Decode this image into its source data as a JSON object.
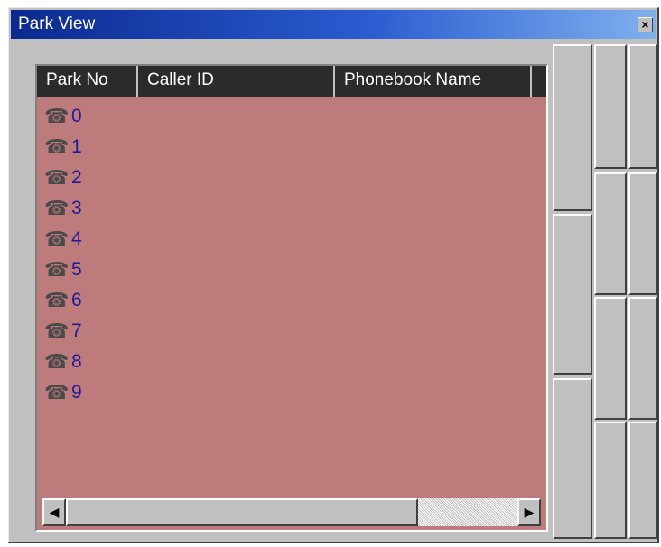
{
  "window": {
    "title": "Park View",
    "close_label": "×"
  },
  "columns": [
    {
      "label": "Park No"
    },
    {
      "label": "Caller ID"
    },
    {
      "label": "Phonebook Name"
    }
  ],
  "rows": [
    {
      "park_no": "0",
      "icon": "phone-icon"
    },
    {
      "park_no": "1",
      "icon": "phone-icon"
    },
    {
      "park_no": "2",
      "icon": "phone-icon"
    },
    {
      "park_no": "3",
      "icon": "phone-icon"
    },
    {
      "park_no": "4",
      "icon": "phone-icon"
    },
    {
      "park_no": "5",
      "icon": "phone-icon"
    },
    {
      "park_no": "6",
      "icon": "phone-icon"
    },
    {
      "park_no": "7",
      "icon": "phone-icon"
    },
    {
      "park_no": "8",
      "icon": "phone-icon"
    },
    {
      "park_no": "9",
      "icon": "phone-icon"
    }
  ],
  "scrollbar": {
    "left_arrow": "◀",
    "right_arrow": "▶"
  },
  "colors": {
    "list_background": "#bd7b7b",
    "header_background": "#2b2b2b",
    "number_text": "#1e1a9e",
    "title_gradient_start": "#0b2a8f"
  }
}
